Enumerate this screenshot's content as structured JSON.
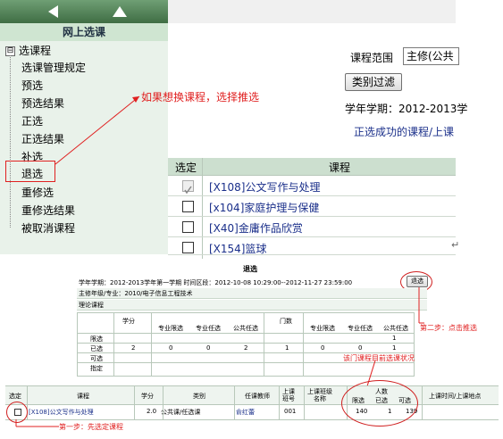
{
  "sidebar": {
    "title": "网上选课",
    "root": {
      "toggle": "⊟",
      "label": "选课程"
    },
    "items": [
      "选课管理规定",
      "预选",
      "预选结果",
      "正选",
      "正选结果",
      "补选",
      "退选",
      "重修选",
      "重修选结果",
      "被取消课程"
    ]
  },
  "annotation_top": "如果想换课程，选择推选",
  "filter": {
    "label": "课程范围",
    "value": "主修(公共",
    "button": "类别过滤"
  },
  "term_line": "学年学期：2012-2013学",
  "success_link": "正选成功的课程/上课",
  "course_table": {
    "headers": [
      "选定",
      "课程"
    ],
    "rows": [
      {
        "name": "[X108]公文写作与处理",
        "checked": true,
        "disabled": true
      },
      {
        "name": "[x104]家庭护理与保健",
        "checked": false,
        "disabled": false
      },
      {
        "name": "[X40]金庸作品欣赏",
        "checked": false,
        "disabled": false
      },
      {
        "name": "[X154]篮球",
        "checked": false,
        "disabled": false
      }
    ]
  },
  "wave_char": "↵",
  "bottom": {
    "title": "退选",
    "term_info": "学年学期：2012-2013学年第一学期  时间区段：2012-10-08 10:29:00--2012-11-27 23:59:00",
    "major_info": "主修年级/专业：2010/电子信息工程技术",
    "section": "理论课程",
    "button": "退选",
    "step2": "第二步：点击推选",
    "summary": {
      "headers": [
        "学分",
        "专业限选",
        "专业任选",
        "公共任选",
        "门数",
        "专业限选",
        "专业任选",
        "公共任选"
      ],
      "rows": [
        {
          "label": "限选",
          "values": [
            "",
            "",
            "",
            "",
            "",
            "",
            "",
            "1"
          ]
        },
        {
          "label": "已选",
          "values": [
            "2",
            "0",
            "0",
            "2",
            "1",
            "0",
            "0",
            "1"
          ]
        },
        {
          "label": "可选",
          "values": [
            "",
            "",
            "",
            "",
            "",
            "",
            "",
            ""
          ]
        },
        {
          "label": "指定",
          "values": [
            "",
            "",
            "",
            "",
            "",
            "",
            "",
            ""
          ]
        }
      ]
    },
    "status_note": "该门课程目前选课状况",
    "grid": {
      "headers": [
        "选定",
        "课程",
        "学分",
        "类别",
        "任课教师",
        "上课\n班号",
        "上课班级\n名称",
        "人数",
        "上课时间/上课地点"
      ],
      "sub_headers": [
        "限选",
        "已选",
        "可选"
      ],
      "row": {
        "course": "[X108]公文写作与处理",
        "credit": "2.0",
        "category": "公共课/任选课",
        "teacher": "俞红蕾",
        "class_no": "001",
        "class_name": "",
        "limit": "140",
        "chosen": "1",
        "avail": "139",
        "time_place": ""
      }
    },
    "step1": "第一步：先选定课程"
  }
}
